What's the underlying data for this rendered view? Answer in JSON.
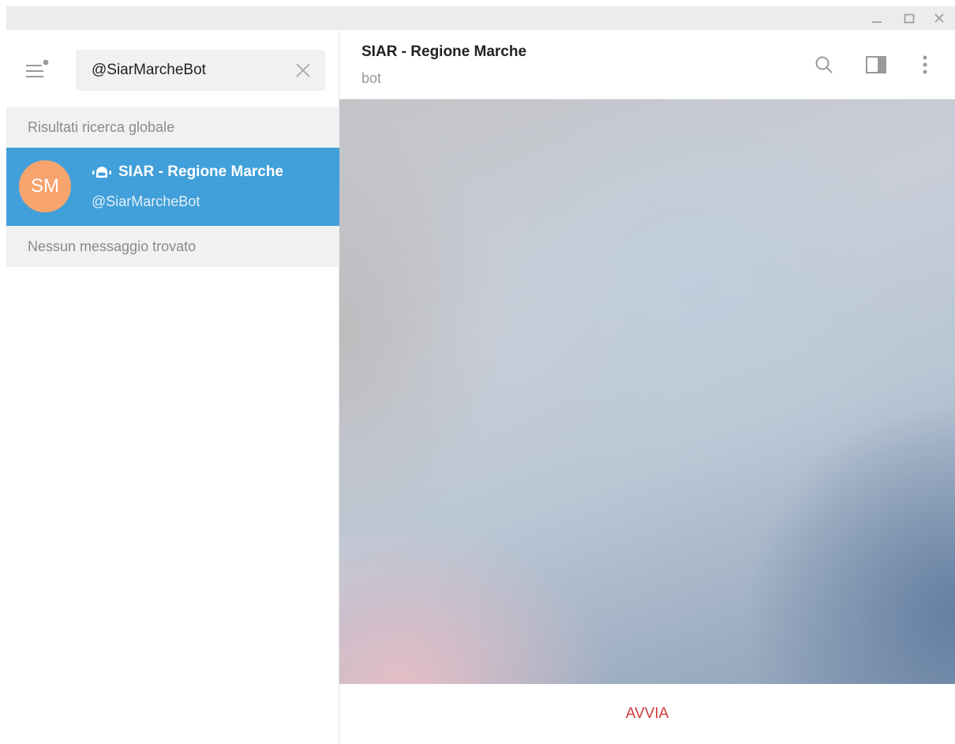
{
  "window": {
    "controls": {
      "minimize": "minimize-icon",
      "maximize": "maximize-icon",
      "close": "close-icon"
    }
  },
  "sidebar": {
    "menu_icon": "hamburger-menu-icon",
    "search": {
      "value": "@SiarMarcheBot",
      "clear_icon": "close-icon"
    },
    "global_results_header": "Risultati ricerca globale",
    "results": [
      {
        "avatar_initials": "SM",
        "avatar_color": "#f8a46f",
        "icon": "bot-icon",
        "title": "SIAR - Regione Marche",
        "username": "@SiarMarcheBot"
      }
    ],
    "no_messages_text": "Nessun messaggio trovato"
  },
  "chat": {
    "title": "SIAR - Regione Marche",
    "status": "bot",
    "header_icons": [
      "search-icon",
      "side-panel-icon",
      "more-vertical-icon"
    ],
    "start_button": "AVVIA"
  },
  "colors": {
    "selection": "#419fd9",
    "start_button": "#d13a3a",
    "section_background": "#f1f1f1"
  }
}
